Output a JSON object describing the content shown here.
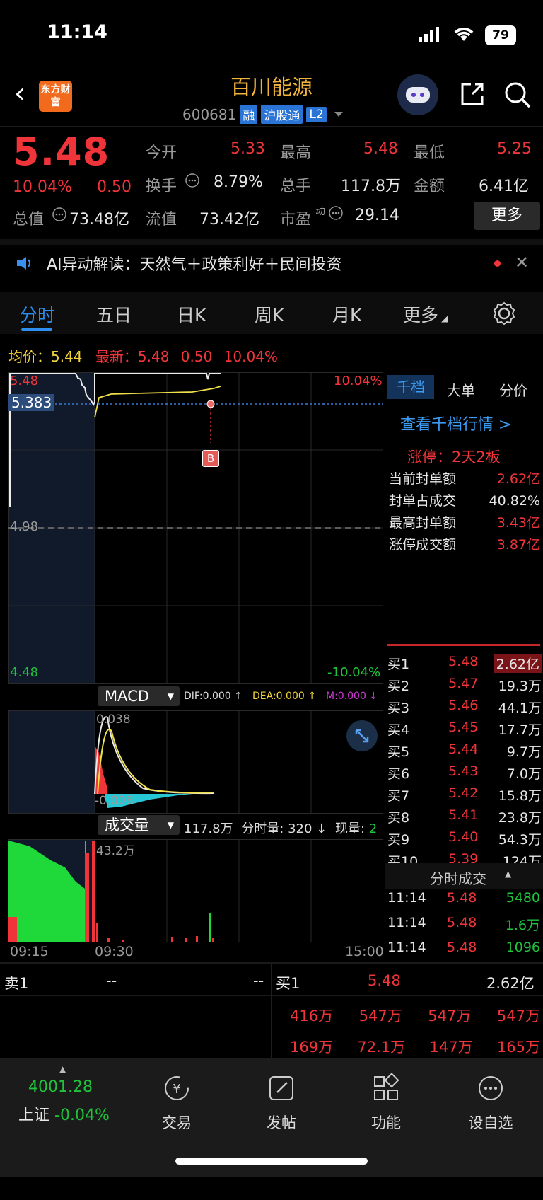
{
  "status": {
    "time": "11:14",
    "battery": "79"
  },
  "header": {
    "logo_text": "东方财富",
    "stock_name": "百川能源",
    "code": "600681",
    "tags": [
      "融",
      "沪股通",
      "L2"
    ]
  },
  "quote": {
    "price": "5.48",
    "change_pct": "10.04%",
    "change": "0.50",
    "fields": {
      "open_label": "今开",
      "open": "5.33",
      "high_label": "最高",
      "high": "5.48",
      "low_label": "最低",
      "low": "5.25",
      "turnover_label": "换手",
      "turnover": "8.79%",
      "volume_label": "总手",
      "volume": "117.8万",
      "amount_label": "金额",
      "amount": "6.41亿",
      "total_cap_label": "总值",
      "total_cap": "73.48亿",
      "float_cap_label": "流值",
      "float_cap": "73.42亿",
      "pe_label": "市盈",
      "pe_sup": "动",
      "pe": "29.14"
    },
    "more_button": "更多"
  },
  "ai_news": {
    "text": "AI异动解读：天然气＋政策利好＋民间投资"
  },
  "tabs": [
    "分时",
    "五日",
    "日K",
    "周K",
    "月K",
    "更多"
  ],
  "intraday": {
    "avg_label": "均价：",
    "avg": "5.44",
    "latest_label": "最新：",
    "latest": "5.48",
    "latest_change": "0.50",
    "latest_pct": "10.04%",
    "y_top": "5.48",
    "y_mid": "4.98",
    "y_bottom": "4.48",
    "pct_top": "10.04%",
    "pct_bottom": "-10.04%",
    "cursor_price": "5.383",
    "marker": "B"
  },
  "macd": {
    "selector": "MACD",
    "dif": "DIF:0.000 ↑",
    "dea": "DEA:0.000 ↑",
    "m": "M:0.000 ↓",
    "top": "0.038",
    "bottom": "-0.008"
  },
  "volume": {
    "selector": "成交量",
    "total": "117.8万",
    "tick_label": "分时量:",
    "tick": "320 ↓",
    "now_label": "现量:",
    "now": "2",
    "max": "43.2万",
    "times": [
      "09:15",
      "09:30",
      "15:00"
    ]
  },
  "side_panel": {
    "tabs": [
      "千档",
      "大单",
      "分价"
    ],
    "link": "查看千档行情 >",
    "limit_up": "涨停：2天2板",
    "stats": [
      {
        "label": "当前封单额",
        "value": "2.62亿"
      },
      {
        "label": "封单占成交",
        "value": "40.82%"
      },
      {
        "label": "最高封单额",
        "value": "3.43亿"
      },
      {
        "label": "涨停成交额",
        "value": "3.87亿"
      }
    ],
    "bids": [
      {
        "label": "买1",
        "price": "5.48",
        "vol": "2.62亿"
      },
      {
        "label": "买2",
        "price": "5.47",
        "vol": "19.3万"
      },
      {
        "label": "买3",
        "price": "5.46",
        "vol": "44.1万"
      },
      {
        "label": "买4",
        "price": "5.45",
        "vol": "17.7万"
      },
      {
        "label": "买5",
        "price": "5.44",
        "vol": "9.7万"
      },
      {
        "label": "买6",
        "price": "5.43",
        "vol": "7.0万"
      },
      {
        "label": "买7",
        "price": "5.42",
        "vol": "15.8万"
      },
      {
        "label": "买8",
        "price": "5.41",
        "vol": "23.8万"
      },
      {
        "label": "买9",
        "price": "5.40",
        "vol": "54.3万"
      },
      {
        "label": "买10",
        "price": "5.39",
        "vol": "124万"
      }
    ],
    "ticks_title": "分时成交",
    "ticks": [
      {
        "time": "11:14",
        "price": "5.48",
        "vol": "5480"
      },
      {
        "time": "11:14",
        "price": "5.48",
        "vol": "1.6万"
      },
      {
        "time": "11:14",
        "price": "5.48",
        "vol": "1096"
      }
    ]
  },
  "orderbook": {
    "sell1_label": "卖1",
    "sell1_price": "--",
    "sell1_vol": "--",
    "buy1_label": "买1",
    "buy1_price": "5.48",
    "buy1_vol": "2.62亿",
    "queue_row1": [
      "416万",
      "547万",
      "547万",
      "547万"
    ],
    "queue_row2": [
      "169万",
      "72.1万",
      "147万",
      "165万"
    ]
  },
  "bottom_nav": {
    "index_value": "4001.28",
    "index_name": "上证",
    "index_pct": "-0.04%",
    "items": [
      "交易",
      "发帖",
      "功能",
      "设自选"
    ]
  }
}
